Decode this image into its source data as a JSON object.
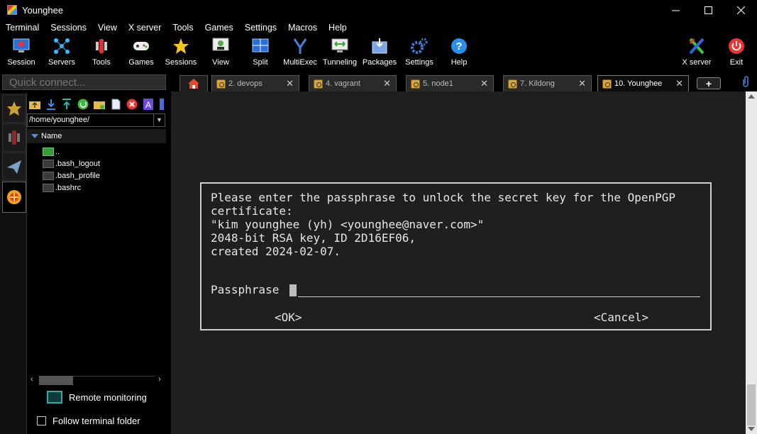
{
  "window": {
    "title": "Younghee"
  },
  "menu": [
    "Terminal",
    "Sessions",
    "View",
    "X server",
    "Tools",
    "Games",
    "Settings",
    "Macros",
    "Help"
  ],
  "toolbar": {
    "session": "Session",
    "servers": "Servers",
    "tools": "Tools",
    "games": "Games",
    "sessions": "Sessions",
    "view": "View",
    "split": "Split",
    "multiexec": "MultiExec",
    "tunneling": "Tunneling",
    "packages": "Packages",
    "settings": "Settings",
    "help": "Help",
    "xserver": "X server",
    "exit": "Exit"
  },
  "quick_connect": {
    "placeholder": "Quick connect..."
  },
  "tabs": [
    "2. devops",
    "4. vagrant",
    "5. node1",
    "7. Kildong",
    "10. Younghee"
  ],
  "file_browser": {
    "path": "/home/younghee/",
    "column": "Name",
    "files": [
      "..",
      ".bash_logout",
      ".bash_profile",
      ".bashrc"
    ],
    "remote_monitoring": "Remote monitoring",
    "follow_folder": "Follow terminal folder"
  },
  "dialog": {
    "lines": [
      "Please enter the passphrase to unlock the secret key for the OpenPGP",
      "certificate:",
      "\"kim younghee (yh) <younghee@naver.com>\"",
      "2048-bit RSA key, ID 2D16EF06,",
      "created 2024-02-07."
    ],
    "passphrase_label": "Passphrase",
    "ok": "<OK>",
    "cancel": "<Cancel>"
  }
}
